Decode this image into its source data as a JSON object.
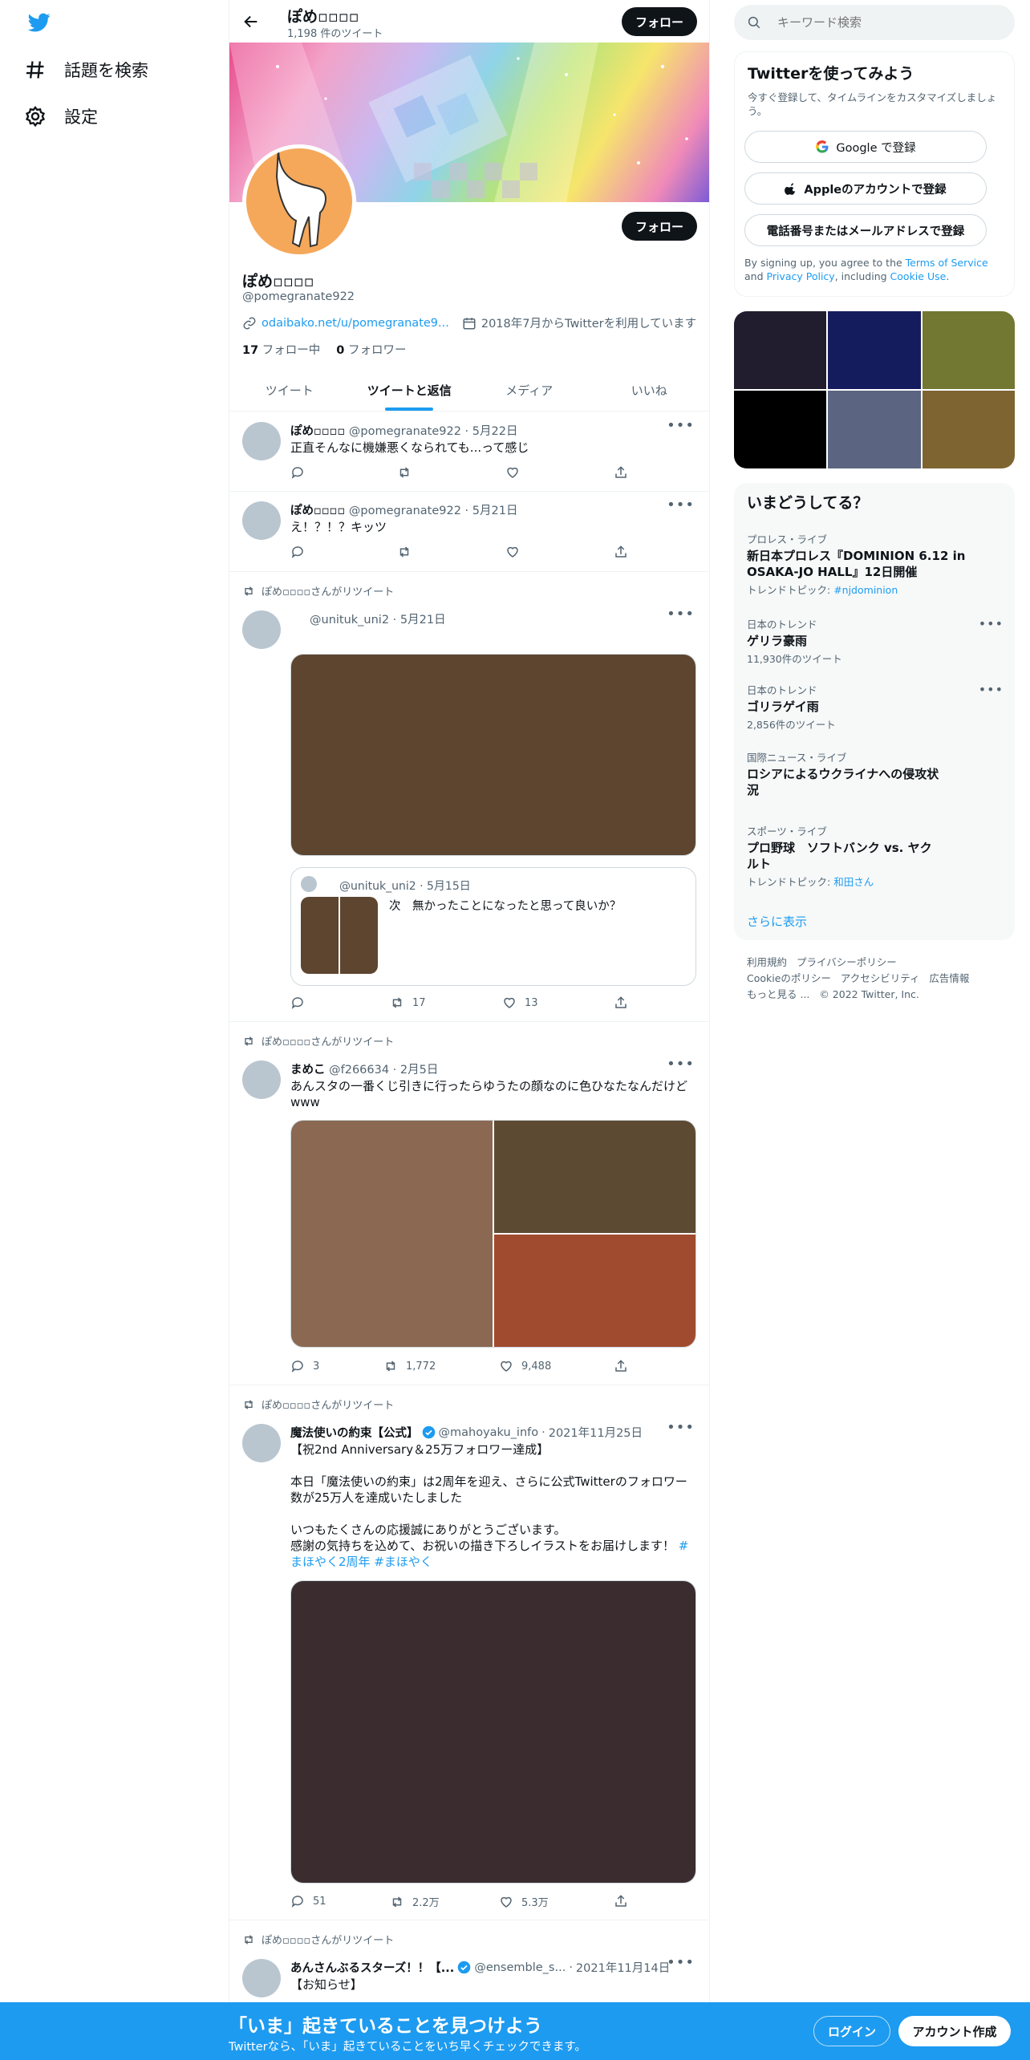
{
  "nav": {
    "explore_label": "話題を検索",
    "settings_label": "設定"
  },
  "header": {
    "title": "ぽめ▫▫▫▫",
    "tweet_count": "1,198 件のツイート",
    "follow_label": "フォロー"
  },
  "profile": {
    "display_name": "ぽめ▫▫▫▫",
    "handle": "@pomegranate922",
    "follow_label": "フォロー",
    "website": "odaibako.net/u/pomegranate9...",
    "joined": "2018年7月からTwitterを利用しています",
    "following_count": "17",
    "following_label": "フォロー中",
    "followers_count": "0",
    "followers_label": "フォロワー"
  },
  "tabs": [
    {
      "label": "ツイート"
    },
    {
      "label": "ツイートと返信"
    },
    {
      "label": "メディア"
    },
    {
      "label": "いいね"
    }
  ],
  "tweets": [
    {
      "name": "ぽめ▫▫▫▫",
      "handle": "@pomegranate922",
      "date": "5月22日",
      "text": "正直そんなに機嫌悪くなられても...って感じ"
    },
    {
      "name": "ぽめ▫▫▫▫",
      "handle": "@pomegranate922",
      "date": "5月21日",
      "text": "え！？！？キッツ"
    },
    {
      "retweet_by": "ぽめ▫▫▫▫さんがリツイート",
      "handle": "@unituk_uni2",
      "date": "5月21日",
      "quote": {
        "handle": "@unituk_uni2",
        "date": "5月15日",
        "text": "次　無かったことになったと思って良いか？"
      },
      "retweets": "17",
      "likes": "13",
      "media_color": "#5d4530"
    },
    {
      "retweet_by": "ぽめ▫▫▫▫さんがリツイート",
      "name": "まめこ",
      "handle": "@f266634",
      "date": "2月5日",
      "text": "あんスタの一番くじ引きに行ったらゆうたの顔なのに色ひなたなんだけどwww",
      "replies": "3",
      "retweets": "1,772",
      "likes": "9,488",
      "media_colors": [
        "#8a6852",
        "#5d4a33",
        "#a04b2f"
      ]
    },
    {
      "retweet_by": "ぽめ▫▫▫▫さんがリツイート",
      "name": "魔法使いの約束【公式】",
      "handle": "@mahoyaku_info",
      "date": "2021年11月25日",
      "text_lines": [
        "【祝2nd Anniversary＆25万フォロワー達成】",
        "",
        "本日「魔法使いの約束」は2周年を迎え、さらに公式Twitterのフォロワー数が25万人を達成いたしました",
        "",
        "いつもたくさんの応援誠にありがとうございます。",
        "感謝の気持ちを込めて、お祝いの描き下ろしイラストをお届けします！"
      ],
      "hashtags": "#まほやく2周年 #まほやく",
      "replies": "51",
      "retweets": "2.2万",
      "likes": "5.3万",
      "media_color": "#3a2c2f"
    },
    {
      "retweet_by": "ぽめ▫▫▫▫さんがリツイート",
      "name": "あんさんぶるスターズ！！【...",
      "handle": "@ensemble_s...",
      "date": "2021年11月14日",
      "text": "【お知らせ】"
    }
  ],
  "search": {
    "placeholder": "キーワード検索"
  },
  "signup": {
    "title": "Twitterを使ってみよう",
    "subtitle": "今すぐ登録して、タイムラインをカスタマイズしましょう。",
    "google": "Google で登録",
    "apple": "Appleのアカウントで登録",
    "phone": "電話番号またはメールアドレスで登録",
    "legal_prefix": "By signing up, you agree to the ",
    "tos": "Terms of Service",
    "and": " and ",
    "privacy": "Privacy Policy",
    "including": ", including ",
    "cookie": "Cookie Use",
    "period": "."
  },
  "photo_grid": {
    "colors": [
      "#221d2e",
      "#151c5e",
      "#727731",
      "#000000",
      "#5b6582",
      "#7d6431"
    ]
  },
  "trends": {
    "title": "いまどうしてる？",
    "items": [
      {
        "category": "プロレス・ライブ",
        "name": "新日本プロレス『DOMINION 6.12 in OSAKA-JO HALL』12日開催",
        "sub_prefix": "トレンドトピック: ",
        "sub_link": "#njdominion"
      },
      {
        "category": "日本のトレンド",
        "name": "ゲリラ豪雨",
        "sub": "11,930件のツイート"
      },
      {
        "category": "日本のトレンド",
        "name": "ゴリラゲイ雨",
        "sub": "2,856件のツイート"
      },
      {
        "category": "国際ニュース・ライブ",
        "name": "ロシアによるウクライナへの侵攻状況"
      },
      {
        "category": "スポーツ・ライブ",
        "name": "プロ野球　ソフトバンク vs. ヤクルト",
        "sub_prefix": "トレンドトピック: ",
        "sub_link": "和田さん"
      }
    ],
    "show_more": "さらに表示"
  },
  "footer": {
    "links": [
      "利用規約",
      "プライバシーポリシー",
      "Cookieのポリシー",
      "アクセシビリティ",
      "広告情報",
      "もっと見る ..."
    ],
    "copyright": "© 2022 Twitter, Inc."
  },
  "bottom": {
    "title": "「いま」起きていることを見つけよう",
    "subtitle": "Twitterなら、「いま」起きていることをいち早くチェックできます。",
    "login": "ログイン",
    "signup": "アカウント作成"
  },
  "colors": {
    "accent": "#1d9bf0",
    "bar": "#1d9bf0"
  }
}
